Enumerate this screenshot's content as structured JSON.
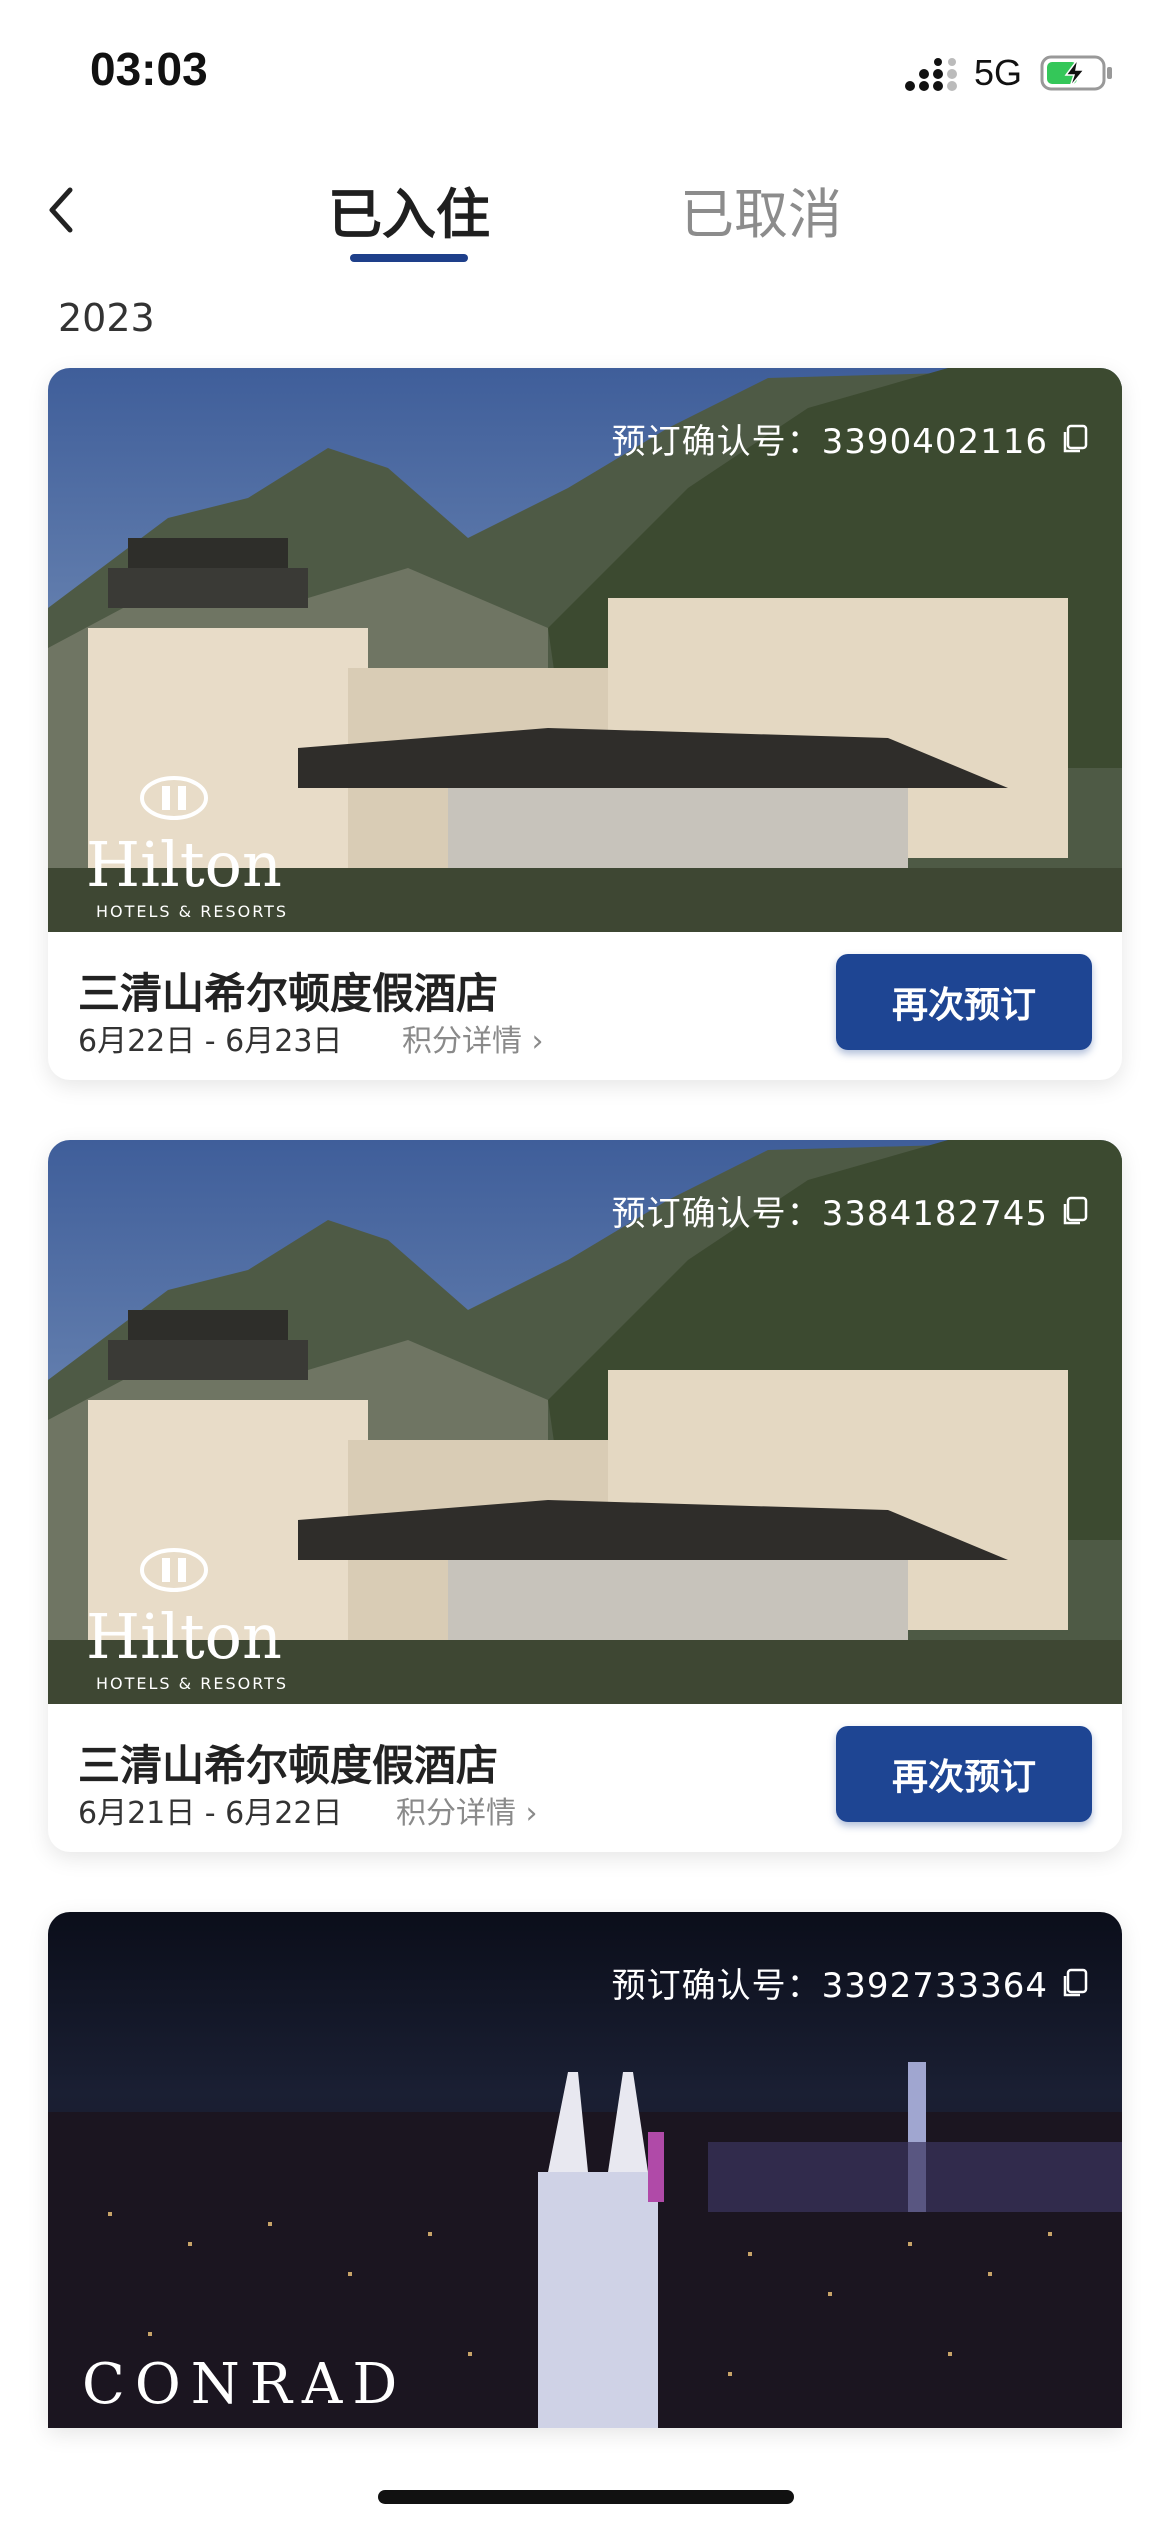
{
  "status_bar": {
    "time": "03:03",
    "network": "5G",
    "signal_icon": "signal-icon",
    "battery_icon": "battery-charging-icon"
  },
  "nav": {
    "back_icon": "chevron-left-icon",
    "tabs": [
      {
        "label": "已入住",
        "active": true
      },
      {
        "label": "已取消",
        "active": false
      }
    ]
  },
  "year_label": "2023",
  "colors": {
    "accent": "#1e3f8a",
    "button": "#1e4593"
  },
  "bookings": [
    {
      "confirmation": "预订确认号：3390402116",
      "brand": "Hilton",
      "brand_sub": "HOTELS & RESORTS",
      "hotel_name": "三清山希尔顿度假酒店",
      "dates": "6月22日 - 6月23日",
      "points_link": "积分详情 ›",
      "button": "再次预订"
    },
    {
      "confirmation": "预订确认号：3384182745",
      "brand": "Hilton",
      "brand_sub": "HOTELS & RESORTS",
      "hotel_name": "三清山希尔顿度假酒店",
      "dates": "6月21日 - 6月22日",
      "points_link": "积分详情 ›",
      "button": "再次预订"
    },
    {
      "confirmation": "预订确认号：3392733364",
      "brand": "CONRAD"
    }
  ]
}
